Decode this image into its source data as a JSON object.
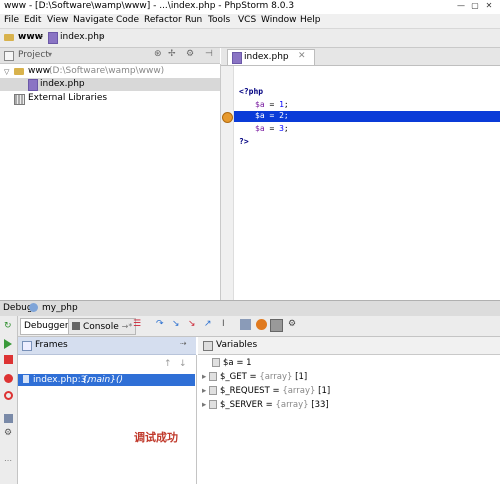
{
  "window": {
    "title": "www - [D:\\Software\\wamp\\www] - ...\\index.php - PhpStorm 8.0.3",
    "btn_min": "—",
    "btn_max": "▢",
    "btn_close": "✕"
  },
  "menu": {
    "items": [
      "File",
      "Edit",
      "View",
      "Navigate",
      "Code",
      "Refactor",
      "Run",
      "Tools",
      "VCS",
      "Window",
      "Help"
    ]
  },
  "navbar": {
    "root": "www",
    "file": "index.php"
  },
  "project": {
    "header_label": "Project",
    "root_label": "www",
    "root_path": "(D:\\Software\\wamp\\www)",
    "file_label": "index.php",
    "libraries_label": "External Libraries"
  },
  "editor": {
    "tab_label": "index.php",
    "lines": [
      {
        "open": "<?php"
      },
      {
        "var": "$a",
        "op": " = ",
        "num": "1",
        "end": ";"
      },
      {
        "var": "$a",
        "op": " = ",
        "num": "2",
        "end": ";"
      },
      {
        "var": "$a",
        "op": " = ",
        "num": "3",
        "end": ";"
      },
      {
        "close": "?>"
      }
    ],
    "highlight_color": "#0a3bd8"
  },
  "debug": {
    "label": "Debug",
    "config": "my_php",
    "tab_debugger": "Debugger",
    "tab_console": "Console"
  },
  "frames": {
    "title": "Frames",
    "selected_file": "index.php:3,",
    "selected_func": "{main}()",
    "note": "调试成功",
    "selection_color": "#2f6fd6"
  },
  "variables": {
    "title": "Variables",
    "rows": [
      {
        "name": "$a",
        "eq": " = ",
        "type": "",
        "value": "1"
      },
      {
        "name": "$_GET",
        "eq": " = ",
        "type": "{array} ",
        "value": "[1]"
      },
      {
        "name": "$_REQUEST",
        "eq": " = ",
        "type": "{array} ",
        "value": "[1]"
      },
      {
        "name": "$_SERVER",
        "eq": " = ",
        "type": "{array} ",
        "value": "[33]"
      }
    ]
  }
}
